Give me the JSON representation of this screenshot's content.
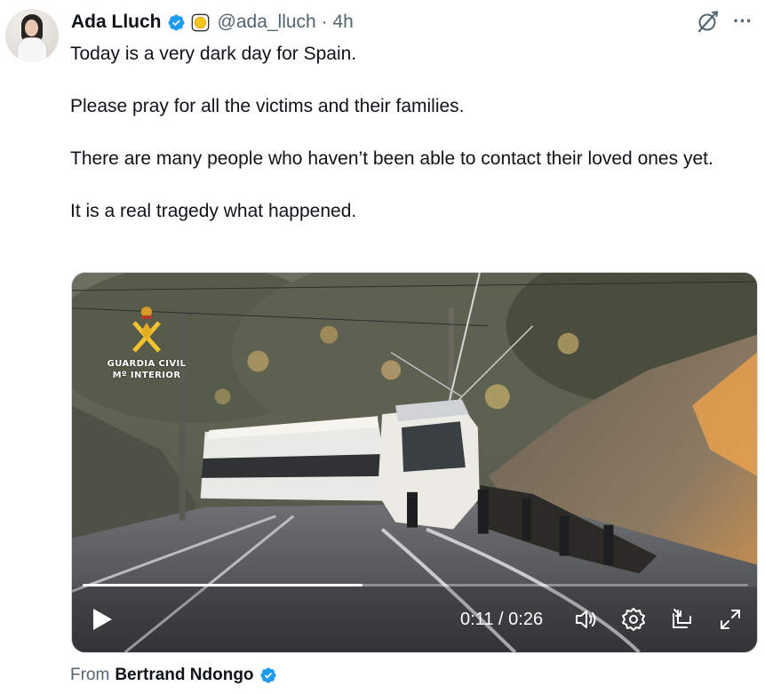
{
  "tweet": {
    "author_name": "Ada Lluch",
    "handle": "@ada_lluch",
    "separator": "·",
    "time_ago": "4h",
    "lines": [
      "Today is a very dark day for Spain.",
      "Please pray for all the victims and their families.",
      "There are many people who haven’t been able to contact their loved ones yet.",
      "It is a real tragedy what happened."
    ]
  },
  "icons": {
    "verified": "verified-badge-icon",
    "affiliate": "gold-affiliate-badge-icon",
    "grok": "grok-icon",
    "more": "more-options-icon",
    "play": "play-icon",
    "volume": "volume-icon",
    "settings": "settings-gear-icon",
    "pip": "picture-in-picture-icon",
    "fullscreen": "fullscreen-icon"
  },
  "video": {
    "overlay_logo_line1": "GUARDIA CIVIL",
    "overlay_logo_line2": "Mº INTERIOR",
    "current_time": "0:11",
    "duration": "0:26",
    "time_separator": "/",
    "progress_fraction": 0.42
  },
  "attribution": {
    "prefix": "From",
    "source_name": "Bertrand Ndongo"
  },
  "colors": {
    "verified_blue": "#1d9bf0",
    "text_primary": "#0f1419",
    "text_secondary": "#536471",
    "affiliate_gold": "#f5c518"
  }
}
